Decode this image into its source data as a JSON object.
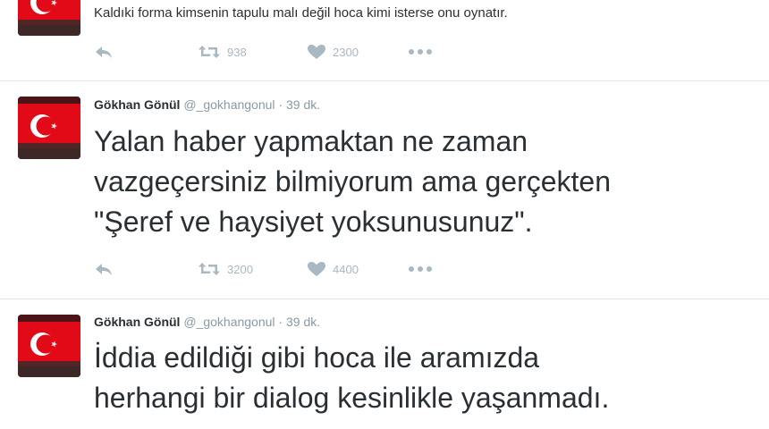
{
  "tweets": [
    {
      "text_lines": [
        "Kaldıki forma kimsenin tapulu malı değil hoca kimi isterse onu oynatır."
      ],
      "retweets": "938",
      "likes": "2300"
    },
    {
      "name": "Gökhan Gönül",
      "handle": "@_gokhangonul",
      "separator": "·",
      "time": "39 dk.",
      "text_lines": [
        "Yalan haber yapmaktan ne zaman",
        "vazgeçersiniz bilmiyorum ama gerçekten",
        "\"Şeref ve haysiyet yoksunusunuz\"."
      ],
      "retweets": "3200",
      "likes": "4400"
    },
    {
      "name": "Gökhan Gönül",
      "handle": "@_gokhangonul",
      "separator": "·",
      "time": "39 dk.",
      "text_lines": [
        "İddia edildiği gibi hoca ile aramızda",
        "herhangi bir dialog kesinlikle yaşanmadı."
      ]
    }
  ],
  "icons": {
    "avatar": "turkish-flag-avatar",
    "reply": "reply-icon",
    "retweet": "retweet-icon",
    "like": "heart-icon",
    "more": "more-icon"
  },
  "colors": {
    "flag_red": "#e30a17",
    "action_gray": "#aab8c2",
    "meta_gray": "#8899a6",
    "divider": "#e1e8ed"
  }
}
